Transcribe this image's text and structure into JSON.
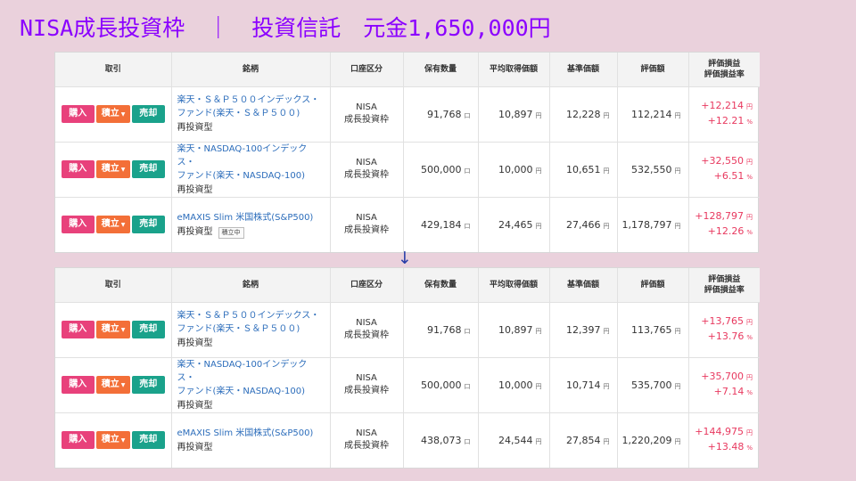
{
  "title": "NISA成長投資枠　｜　投資信託　元金1,650,000円",
  "arrow": "↓",
  "headers": {
    "trade": "取引",
    "fund": "銘柄",
    "account": "口座区分",
    "qty": "保有数量",
    "avg": "平均取得価額",
    "base": "基準価額",
    "value": "評価額",
    "pl_line1": "評価損益",
    "pl_line2": "評価損益率"
  },
  "buttons": {
    "buy": "購入",
    "accum": "積立",
    "sell": "売却",
    "caret": "▼"
  },
  "units": {
    "qty": "口",
    "yen": "円",
    "pct": "%"
  },
  "colors": {
    "buy": "#e8417b",
    "accum": "#f36f38",
    "sell": "#1aa28b",
    "link": "#2c6dbb",
    "gain": "#e8395f",
    "title": "#8b00ff"
  },
  "before": {
    "rows": [
      {
        "fund_line1": "楽天・Ｓ＆Ｐ５００インデックス・",
        "fund_line2": "ファンド(楽天・Ｓ＆Ｐ５００)",
        "fund_sub": "再投資型",
        "tag": "",
        "acct1": "NISA",
        "acct2": "成長投資枠",
        "qty": "91,768",
        "avg": "10,897",
        "base": "12,228",
        "value": "112,214",
        "pl": "+12,214",
        "plr": "+12.21"
      },
      {
        "fund_line1": "楽天・NASDAQ-100インデックス・",
        "fund_line2": "ファンド(楽天・NASDAQ-100)",
        "fund_sub": "再投資型",
        "tag": "",
        "acct1": "NISA",
        "acct2": "成長投資枠",
        "qty": "500,000",
        "avg": "10,000",
        "base": "10,651",
        "value": "532,550",
        "pl": "+32,550",
        "plr": "+6.51"
      },
      {
        "fund_line1": "eMAXIS Slim 米国株式(S&P500)",
        "fund_line2": "",
        "fund_sub": "再投資型",
        "tag": "積立中",
        "acct1": "NISA",
        "acct2": "成長投資枠",
        "qty": "429,184",
        "avg": "24,465",
        "base": "27,466",
        "value": "1,178,797",
        "pl": "+128,797",
        "plr": "+12.26"
      }
    ]
  },
  "after": {
    "rows": [
      {
        "fund_line1": "楽天・Ｓ＆Ｐ５００インデックス・",
        "fund_line2": "ファンド(楽天・Ｓ＆Ｐ５００)",
        "fund_sub": "再投資型",
        "tag": "",
        "acct1": "NISA",
        "acct2": "成長投資枠",
        "qty": "91,768",
        "avg": "10,897",
        "base": "12,397",
        "value": "113,765",
        "pl": "+13,765",
        "plr": "+13.76"
      },
      {
        "fund_line1": "楽天・NASDAQ-100インデックス・",
        "fund_line2": "ファンド(楽天・NASDAQ-100)",
        "fund_sub": "再投資型",
        "tag": "",
        "acct1": "NISA",
        "acct2": "成長投資枠",
        "qty": "500,000",
        "avg": "10,000",
        "base": "10,714",
        "value": "535,700",
        "pl": "+35,700",
        "plr": "+7.14"
      },
      {
        "fund_line1": "eMAXIS Slim 米国株式(S&P500)",
        "fund_line2": "",
        "fund_sub": "再投資型",
        "tag": "",
        "acct1": "NISA",
        "acct2": "成長投資枠",
        "qty": "438,073",
        "avg": "24,544",
        "base": "27,854",
        "value": "1,220,209",
        "pl": "+144,975",
        "plr": "+13.48"
      }
    ]
  }
}
